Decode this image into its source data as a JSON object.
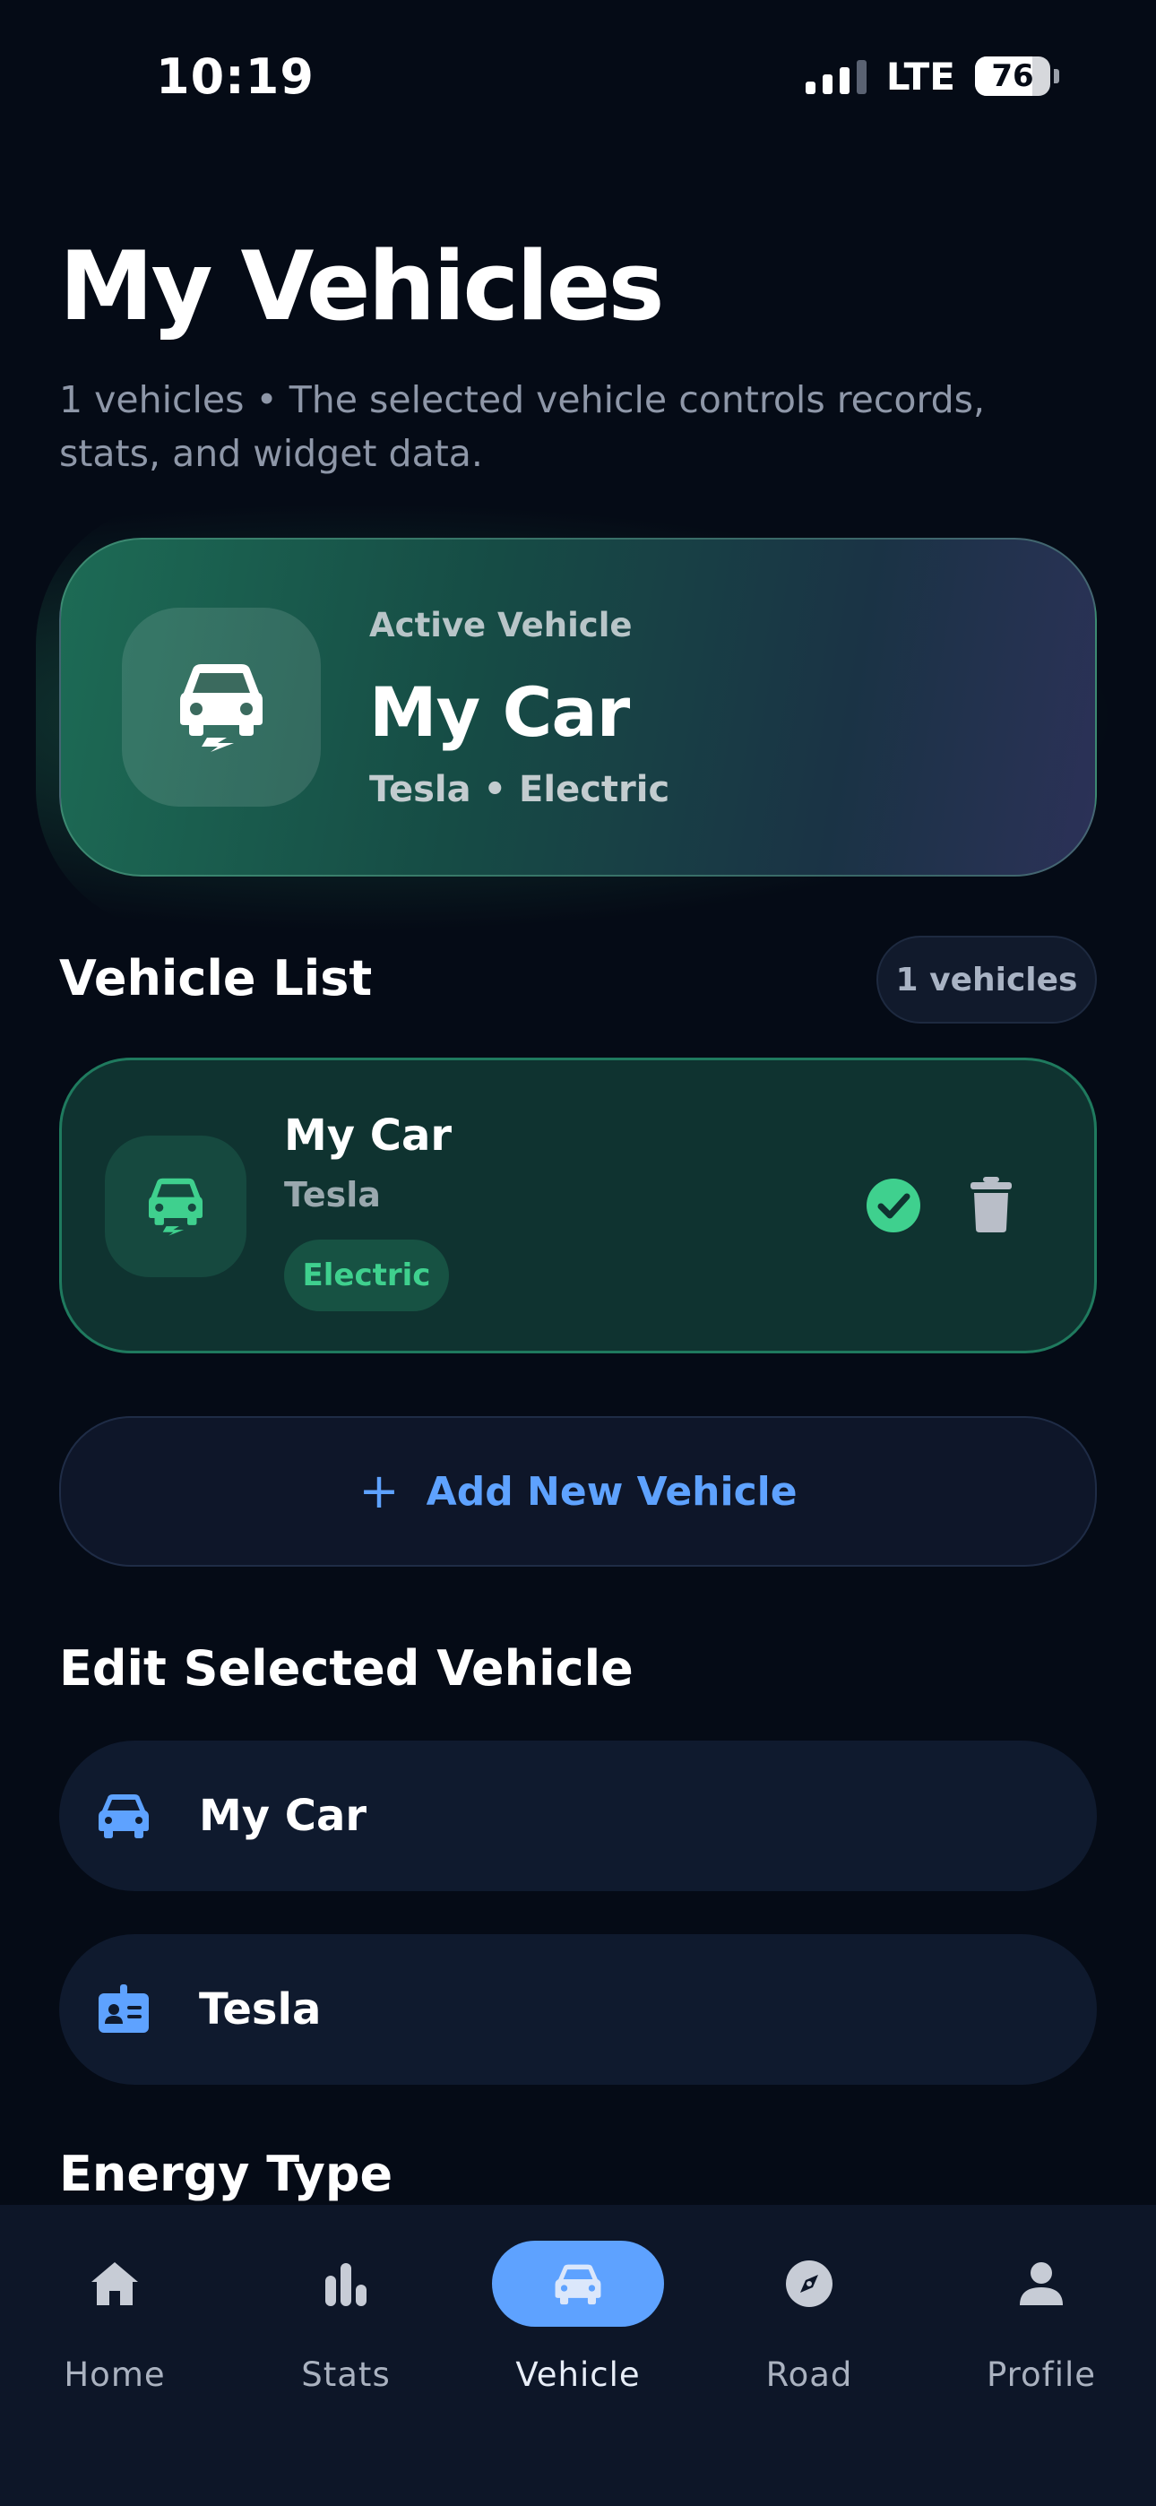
{
  "status_bar": {
    "time": "10:19",
    "network": "LTE",
    "battery": "76"
  },
  "header": {
    "title": "My Vehicles",
    "subtitle": "1 vehicles • The selected vehicle controls records, stats, and widget data."
  },
  "active_vehicle": {
    "label": "Active Vehicle",
    "name": "My Car",
    "meta": "Tesla • Electric",
    "icon": "electric-car-icon"
  },
  "vehicle_list": {
    "title": "Vehicle List",
    "count": "1 vehicles",
    "items": [
      {
        "name": "My Car",
        "make": "Tesla",
        "energy": "Electric",
        "selected": true
      }
    ]
  },
  "add_vehicle": {
    "label": "Add New Vehicle"
  },
  "edit": {
    "title": "Edit Selected Vehicle",
    "name_value": "My Car",
    "brand_value": "Tesla",
    "energy_title": "Energy Type"
  },
  "nav": {
    "items": [
      {
        "label": "Home",
        "icon": "home-icon"
      },
      {
        "label": "Stats",
        "icon": "stats-icon"
      },
      {
        "label": "Vehicle",
        "icon": "car-icon",
        "active": true
      },
      {
        "label": "Road",
        "icon": "compass-icon"
      },
      {
        "label": "Profile",
        "icon": "person-icon"
      }
    ]
  },
  "colors": {
    "background": "#050b16",
    "accent_blue": "#5ea2ff",
    "accent_green": "#3fd08e",
    "card": "#0f1a2e"
  }
}
